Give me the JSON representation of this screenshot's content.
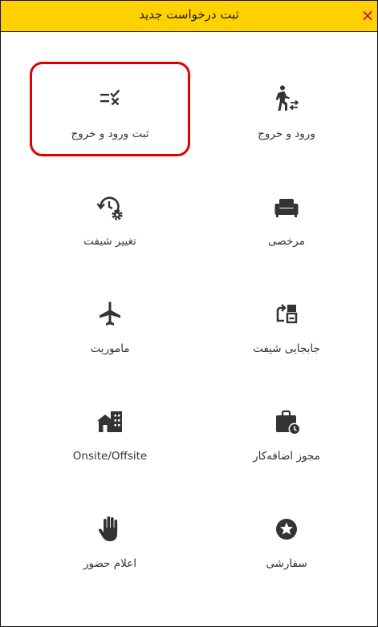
{
  "header": {
    "title": "ثبت درخواست جدید",
    "close_symbol": "×",
    "close_icon": "close-icon",
    "accent_color": "#ffd100",
    "close_color": "#e00000"
  },
  "tiles": [
    {
      "label": "ثبت ورود و خروج",
      "icon": "check-cross-list-icon",
      "selected": true
    },
    {
      "label": "ورود و خروج",
      "icon": "walking-person-arrows-icon",
      "selected": false
    },
    {
      "label": "تغییر شیفت",
      "icon": "history-gear-icon",
      "selected": false
    },
    {
      "label": "مرخصی",
      "icon": "armchair-icon",
      "selected": false
    },
    {
      "label": "ماموریت",
      "icon": "airplane-icon",
      "selected": false
    },
    {
      "label": "جابجایی شیفت",
      "icon": "swap-arrow-calendar-icon",
      "selected": false
    },
    {
      "label": "Onsite/Offsite",
      "icon": "house-building-icon",
      "selected": false
    },
    {
      "label": "مجوز اضافه‌کار",
      "icon": "briefcase-clock-icon",
      "selected": false
    },
    {
      "label": "اعلام حضور",
      "icon": "raised-hand-icon",
      "selected": false
    },
    {
      "label": "سفارشی",
      "icon": "star-circle-icon",
      "selected": false
    }
  ],
  "colors": {
    "icon": "#333333",
    "selection_border": "#e00000"
  }
}
